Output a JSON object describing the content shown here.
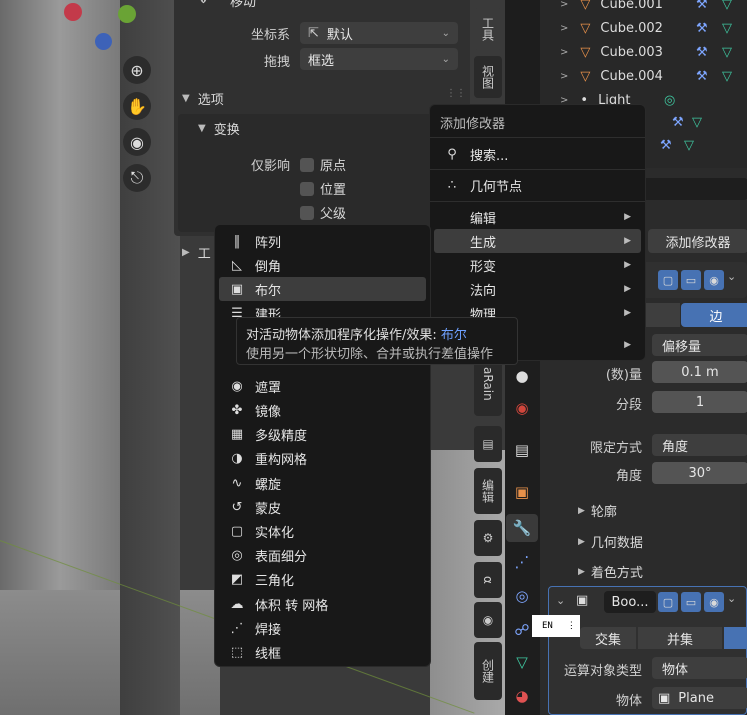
{
  "viewport_panel": {
    "move_title": "移动",
    "coord_label": "坐标系",
    "coord_value": "默认",
    "drag_label": "拖拽",
    "drag_value": "框选",
    "options_label": "选项",
    "transform_label": "变换",
    "affect_only_label": "仅影响",
    "origin_label": "原点",
    "position_label": "位置",
    "parent_label": "父级",
    "workspace_partial": "工"
  },
  "vertical_tabs": [
    "工具",
    "视图",
    "aRain",
    "编辑",
    "创建"
  ],
  "add_modifier_menu": {
    "title": "添加修改器",
    "search": "搜索...",
    "geometry_nodes": "几何节点",
    "categories": [
      {
        "label": "编辑"
      },
      {
        "label": "生成"
      },
      {
        "label": "形变"
      },
      {
        "label": "法向"
      },
      {
        "label": "物理"
      },
      {
        "label": ""
      }
    ]
  },
  "generate_submenu": {
    "items": [
      {
        "label": "阵列",
        "icon": "array-icon"
      },
      {
        "label": "倒角",
        "icon": "bevel-icon"
      },
      {
        "label": "布尔",
        "icon": "boolean-icon"
      },
      {
        "label": "建形",
        "icon": "build-icon"
      },
      {
        "label": "",
        "icon": ""
      },
      {
        "label": "",
        "icon": ""
      },
      {
        "label": "遮罩",
        "icon": "mask-icon"
      },
      {
        "label": "镜像",
        "icon": "mirror-icon"
      },
      {
        "label": "多级精度",
        "icon": "multires-icon"
      },
      {
        "label": "重构网格",
        "icon": "remesh-icon"
      },
      {
        "label": "螺旋",
        "icon": "screw-icon"
      },
      {
        "label": "蒙皮",
        "icon": "skin-icon"
      },
      {
        "label": "实体化",
        "icon": "solidify-icon"
      },
      {
        "label": "表面细分",
        "icon": "subsurf-icon"
      },
      {
        "label": "三角化",
        "icon": "triangulate-icon"
      },
      {
        "label": "体积 转 网格",
        "icon": "volume-to-mesh-icon"
      },
      {
        "label": "焊接",
        "icon": "weld-icon"
      },
      {
        "label": "线框",
        "icon": "wireframe-icon"
      }
    ]
  },
  "tooltip": {
    "line1_prefix": "对活动物体添加程序化操作/效果: ",
    "line1_highlight": "布尔",
    "line2": "使用另一个形状切除、合并或执行差值操作"
  },
  "outliner": {
    "items": [
      "Cube.001",
      "Cube.002",
      "Cube.003",
      "Cube.004",
      "Light"
    ]
  },
  "properties": {
    "add_modifier_button": "添加修改器",
    "offset_value": "偏移量",
    "count_label": "(数)量",
    "count_value": "0.1 m",
    "segments_label": "分段",
    "segments_value": "1",
    "limit_method_label": "限定方式",
    "limit_method_value": "角度",
    "angle_label": "角度",
    "angle_value": "30°",
    "profile_label": "轮廓",
    "geometry_label": "几何数据",
    "shading_label": "着色方式",
    "boolean_name": "Boo...",
    "intersect_label": "交集",
    "union_label": "并集",
    "operand_type_label": "运算对象类型",
    "operand_type_value": "物体",
    "object_label": "物体",
    "object_value": "Plane",
    "ime_indicator": "EN"
  },
  "colors": {
    "accent": "#4772b3",
    "highlight_text": "#6ea0ff",
    "selection": "#3d3d3d",
    "geonode_green": "#3fc7a0",
    "modifier_blue": "#7ea6ff",
    "object_orange": "#e8914a"
  }
}
